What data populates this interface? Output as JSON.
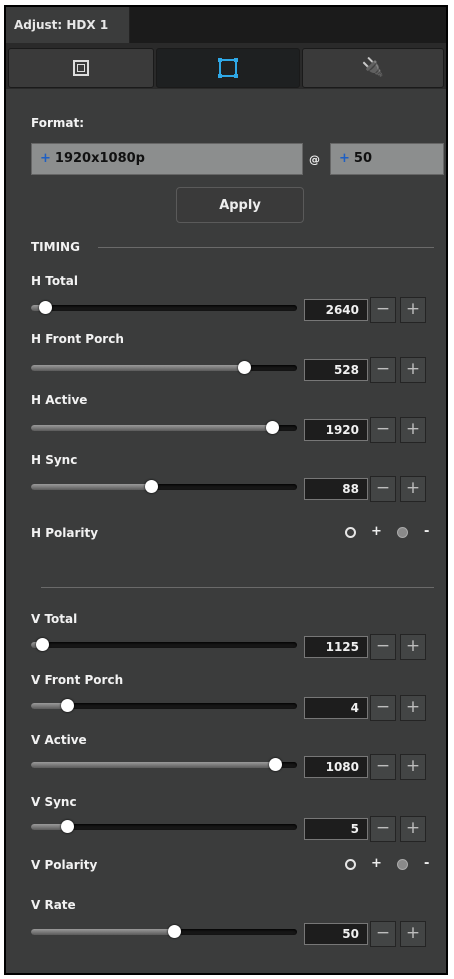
{
  "window": {
    "title": "Adjust: HDX 1"
  },
  "modes": [
    {
      "name": "frame-mode",
      "icon": "frame-icon",
      "active": false
    },
    {
      "name": "crop-mode",
      "icon": "crop-icon",
      "active": true
    },
    {
      "name": "plug-mode",
      "icon": "plug-icon",
      "active": false
    }
  ],
  "format": {
    "label": "Format:",
    "resolution_plus": "+",
    "resolution": "1920x1080p",
    "at": "@",
    "rate_plus": "+",
    "rate": "50",
    "apply_label": "Apply"
  },
  "timing": {
    "title": "TIMING",
    "h_total": {
      "label": "H Total",
      "value": "2640",
      "slider": 0.03
    },
    "h_front_porch": {
      "label": "H Front Porch",
      "value": "528",
      "slider": 0.82
    },
    "h_active": {
      "label": "H Active",
      "value": "1920",
      "slider": 0.93
    },
    "h_sync": {
      "label": "H Sync",
      "value": "88",
      "slider": 0.45
    },
    "h_polarity": {
      "label": "H Polarity",
      "pos": "+",
      "neg": "-",
      "selected": "+"
    },
    "v_total": {
      "label": "V Total",
      "value": "1125",
      "slider": 0.02
    },
    "v_front_porch": {
      "label": "V Front Porch",
      "value": "4",
      "slider": 0.12
    },
    "v_active": {
      "label": "V Active",
      "value": "1080",
      "slider": 0.94
    },
    "v_sync": {
      "label": "V Sync",
      "value": "5",
      "slider": 0.12
    },
    "v_polarity": {
      "label": "V Polarity",
      "pos": "+",
      "neg": "-",
      "selected": "+"
    },
    "v_rate": {
      "label": "V Rate",
      "value": "50",
      "slider": 0.54
    }
  },
  "stepper": {
    "minus": "−",
    "plus": "+"
  }
}
